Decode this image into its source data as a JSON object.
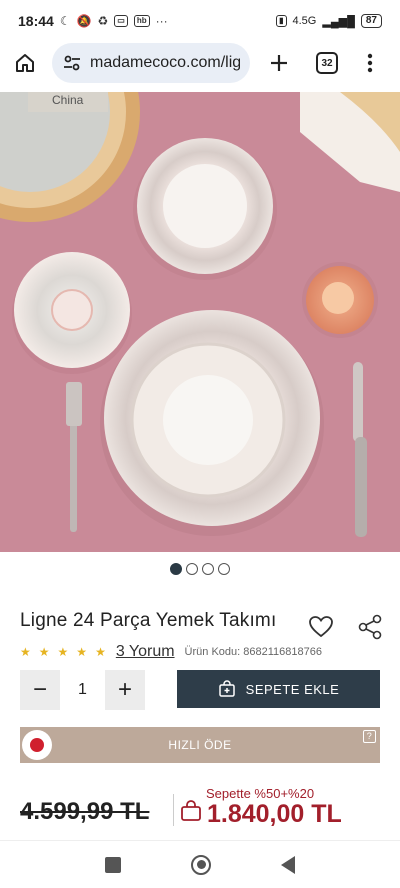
{
  "status_bar": {
    "time": "18:44",
    "net_label": "4.5G",
    "battery": "87"
  },
  "browser": {
    "url": "madamecoco.com/lig",
    "tab_count": "32"
  },
  "hero": {
    "china_text": "China",
    "slide_count": 4,
    "active_slide": 0
  },
  "product": {
    "title": "Ligne 24 Parça Yemek Takımı",
    "rating_stars": 5,
    "reviews_label": "3 Yorum",
    "sku_label": "Ürün Kodu: 8682116818766"
  },
  "purchase": {
    "quantity": "1",
    "minus": "−",
    "plus": "+",
    "add_to_cart_label": "SEPETE EKLE",
    "quick_pay_label": "HIZLI ÖDE",
    "help_glyph": "?"
  },
  "price": {
    "old": "4.599,99 TL",
    "promo": "Sepette %50+%20",
    "new": "1.840,00 TL"
  },
  "colors": {
    "brand_dark": "#2e3d49",
    "sale_red": "#a21f2b",
    "quick_pay": "#bda99a",
    "star": "#e6b422"
  }
}
